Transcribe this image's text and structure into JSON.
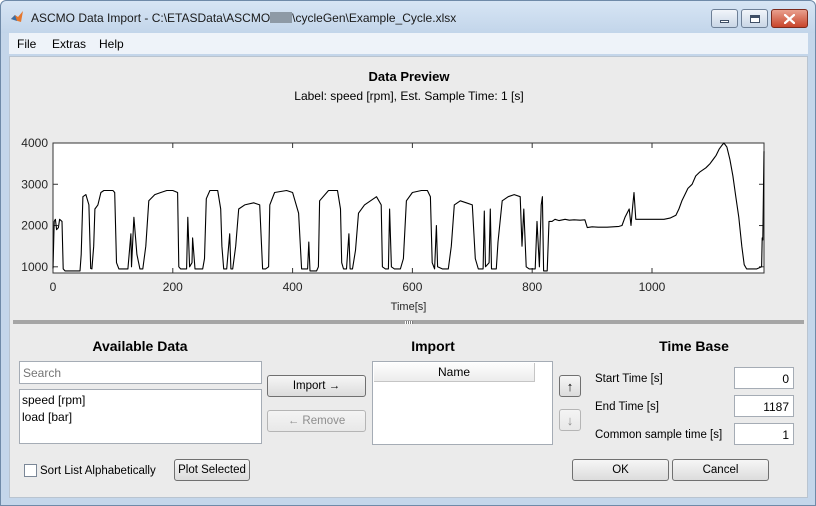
{
  "window": {
    "title_prefix": "ASCMO Data Import - C:\\ETASData\\ASCMO",
    "title_suffix": "\\cycleGen\\Example_Cycle.xlsx",
    "controls": [
      "minimize-icon",
      "maximize-icon",
      "close-icon"
    ]
  },
  "menu": {
    "items": [
      "File",
      "Extras",
      "Help"
    ]
  },
  "preview": {
    "title": "Data Preview",
    "subtitle": "Label: speed [rpm],  Est. Sample Time: 1 [s]"
  },
  "chart_data": {
    "type": "line",
    "title": "",
    "xlabel": "Time[s]",
    "ylabel": "",
    "xlim": [
      0,
      1187
    ],
    "ylim": [
      850,
      4000
    ],
    "xticks": [
      0,
      200,
      400,
      600,
      800,
      1000
    ],
    "yticks": [
      1000,
      2000,
      3000,
      4000
    ],
    "grid": false,
    "series": [
      {
        "points": [
          [
            0,
            960
          ],
          [
            2,
            2100
          ],
          [
            4,
            2150
          ],
          [
            6,
            1900
          ],
          [
            9,
            1950
          ],
          [
            11,
            2150
          ],
          [
            15,
            2100
          ],
          [
            17,
            950
          ],
          [
            20,
            900
          ],
          [
            25,
            900
          ],
          [
            30,
            900
          ],
          [
            40,
            900
          ],
          [
            45,
            900
          ],
          [
            47,
            1300
          ],
          [
            50,
            2700
          ],
          [
            55,
            2750
          ],
          [
            60,
            2500
          ],
          [
            63,
            960
          ],
          [
            65,
            950
          ],
          [
            68,
            1500
          ],
          [
            70,
            2400
          ],
          [
            75,
            2500
          ],
          [
            80,
            2800
          ],
          [
            85,
            2850
          ],
          [
            90,
            2850
          ],
          [
            100,
            2850
          ],
          [
            103,
            2800
          ],
          [
            106,
            1100
          ],
          [
            110,
            950
          ],
          [
            125,
            950
          ],
          [
            130,
            1800
          ],
          [
            131,
            1000
          ],
          [
            135,
            2200
          ],
          [
            140,
            1300
          ],
          [
            145,
            950
          ],
          [
            150,
            950
          ],
          [
            155,
            1500
          ],
          [
            160,
            2600
          ],
          [
            170,
            2750
          ],
          [
            180,
            2800
          ],
          [
            190,
            2850
          ],
          [
            200,
            2850
          ],
          [
            208,
            2800
          ],
          [
            210,
            1000
          ],
          [
            213,
            950
          ],
          [
            223,
            950
          ],
          [
            225,
            2200
          ],
          [
            228,
            1000
          ],
          [
            232,
            1100
          ],
          [
            233,
            1700
          ],
          [
            237,
            950
          ],
          [
            250,
            950
          ],
          [
            253,
            1200
          ],
          [
            256,
            2650
          ],
          [
            262,
            2850
          ],
          [
            275,
            2850
          ],
          [
            280,
            2400
          ],
          [
            282,
            1500
          ],
          [
            285,
            950
          ],
          [
            290,
            950
          ],
          [
            295,
            1800
          ],
          [
            297,
            950
          ],
          [
            300,
            950
          ],
          [
            305,
            1500
          ],
          [
            310,
            2400
          ],
          [
            320,
            2500
          ],
          [
            335,
            2550
          ],
          [
            345,
            2500
          ],
          [
            350,
            950
          ],
          [
            355,
            950
          ],
          [
            360,
            1000
          ],
          [
            362,
            2500
          ],
          [
            370,
            2800
          ],
          [
            390,
            2850
          ],
          [
            400,
            2800
          ],
          [
            410,
            2300
          ],
          [
            415,
            950
          ],
          [
            425,
            950
          ],
          [
            427,
            1600
          ],
          [
            429,
            900
          ],
          [
            440,
            900
          ],
          [
            443,
            1000
          ],
          [
            445,
            2600
          ],
          [
            460,
            2850
          ],
          [
            475,
            2850
          ],
          [
            480,
            2400
          ],
          [
            482,
            1100
          ],
          [
            485,
            950
          ],
          [
            490,
            950
          ],
          [
            494,
            1800
          ],
          [
            496,
            950
          ],
          [
            500,
            950
          ],
          [
            505,
            1400
          ],
          [
            510,
            2300
          ],
          [
            520,
            2500
          ],
          [
            540,
            2700
          ],
          [
            548,
            2500
          ],
          [
            550,
            1000
          ],
          [
            555,
            950
          ],
          [
            560,
            950
          ],
          [
            562,
            2400
          ],
          [
            565,
            1000
          ],
          [
            570,
            950
          ],
          [
            580,
            950
          ],
          [
            585,
            1200
          ],
          [
            590,
            2600
          ],
          [
            600,
            2800
          ],
          [
            615,
            2850
          ],
          [
            625,
            2850
          ],
          [
            630,
            2700
          ],
          [
            633,
            1100
          ],
          [
            637,
            950
          ],
          [
            640,
            2000
          ],
          [
            642,
            1000
          ],
          [
            650,
            950
          ],
          [
            660,
            950
          ],
          [
            665,
            1500
          ],
          [
            670,
            2500
          ],
          [
            680,
            2600
          ],
          [
            690,
            2550
          ],
          [
            700,
            2500
          ],
          [
            705,
            1200
          ],
          [
            710,
            950
          ],
          [
            718,
            950
          ],
          [
            720,
            2350
          ],
          [
            722,
            1000
          ],
          [
            728,
            1100
          ],
          [
            730,
            2400
          ],
          [
            732,
            950
          ],
          [
            740,
            950
          ],
          [
            743,
            1600
          ],
          [
            750,
            2600
          ],
          [
            760,
            2700
          ],
          [
            770,
            2750
          ],
          [
            780,
            2700
          ],
          [
            783,
            1500
          ],
          [
            786,
            2400
          ],
          [
            790,
            1000
          ],
          [
            795,
            950
          ],
          [
            805,
            950
          ],
          [
            808,
            2100
          ],
          [
            812,
            1000
          ],
          [
            815,
            2500
          ],
          [
            817,
            2700
          ],
          [
            819,
            900
          ],
          [
            825,
            900
          ],
          [
            828,
            2100
          ],
          [
            833,
            2100
          ],
          [
            838,
            2150
          ],
          [
            845,
            2120
          ],
          [
            855,
            2150
          ],
          [
            862,
            2130
          ],
          [
            870,
            2140
          ],
          [
            880,
            2130
          ],
          [
            888,
            2140
          ],
          [
            892,
            1950
          ],
          [
            900,
            1970
          ],
          [
            910,
            1960
          ],
          [
            925,
            1960
          ],
          [
            935,
            1970
          ],
          [
            945,
            1980
          ],
          [
            950,
            2000
          ],
          [
            955,
            2200
          ],
          [
            962,
            2400
          ],
          [
            965,
            2000
          ],
          [
            968,
            2500
          ],
          [
            970,
            2800
          ],
          [
            973,
            2150
          ],
          [
            980,
            2150
          ],
          [
            1000,
            2150
          ],
          [
            1020,
            2150
          ],
          [
            1030,
            2180
          ],
          [
            1040,
            2250
          ],
          [
            1045,
            2400
          ],
          [
            1050,
            2600
          ],
          [
            1055,
            2750
          ],
          [
            1060,
            2900
          ],
          [
            1067,
            3000
          ],
          [
            1073,
            3200
          ],
          [
            1080,
            3300
          ],
          [
            1090,
            3400
          ],
          [
            1097,
            3500
          ],
          [
            1102,
            3600
          ],
          [
            1107,
            3700
          ],
          [
            1112,
            3850
          ],
          [
            1117,
            3950
          ],
          [
            1120,
            4000
          ],
          [
            1125,
            3900
          ],
          [
            1130,
            3600
          ],
          [
            1135,
            3200
          ],
          [
            1140,
            2700
          ],
          [
            1145,
            2200
          ],
          [
            1150,
            1500
          ],
          [
            1154,
            1050
          ],
          [
            1158,
            950
          ],
          [
            1165,
            950
          ],
          [
            1175,
            950
          ],
          [
            1183,
            1000
          ],
          [
            1184,
            1700
          ],
          [
            1185,
            1650
          ],
          [
            1187,
            3800
          ]
        ]
      }
    ]
  },
  "available": {
    "title": "Available Data",
    "search_placeholder": "Search",
    "items": [
      "speed [rpm]",
      "load [bar]"
    ]
  },
  "buttons": {
    "import": "Import →",
    "remove": "← Remove",
    "up": "↑",
    "down": "↓",
    "plot_selected": "Plot Selected",
    "ok": "OK",
    "cancel": "Cancel"
  },
  "import_panel": {
    "title": "Import",
    "column_header": "Name"
  },
  "time_base": {
    "title": "Time Base",
    "start_label": "Start Time [s]",
    "start_value": "0",
    "end_label": "End Time [s]",
    "end_value": "1187",
    "sample_label": "Common sample time [s]",
    "sample_value": "1"
  },
  "sort_checkbox": {
    "label": "Sort List Alphabetically",
    "checked": false
  }
}
